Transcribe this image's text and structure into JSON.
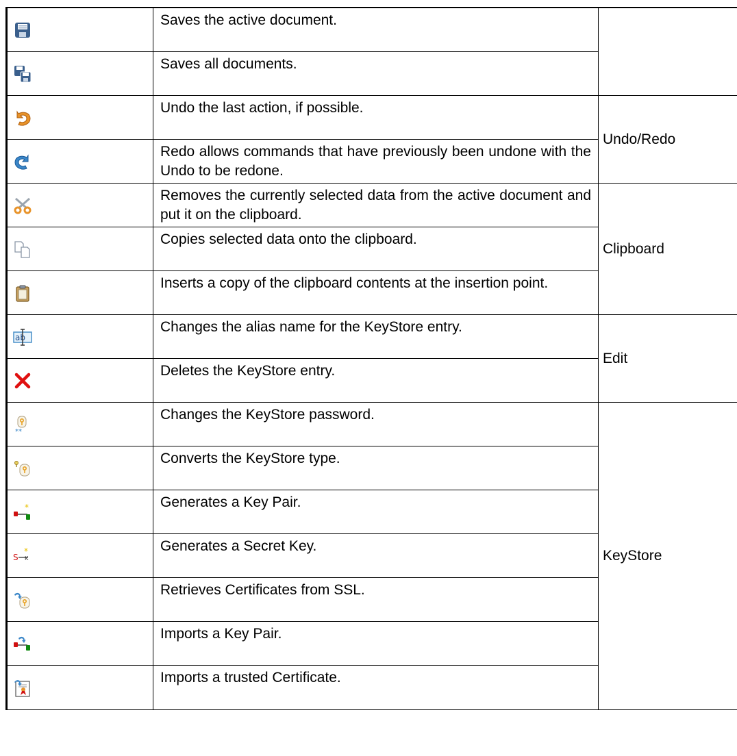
{
  "table": {
    "rows": [
      {
        "icon": "save-icon",
        "description": "Saves the active document."
      },
      {
        "icon": "save-all-icon",
        "description": "Saves all documents."
      },
      {
        "icon": "undo-icon",
        "description": "Undo the last action, if possible."
      },
      {
        "icon": "redo-icon",
        "description": "Redo allows commands that have previously been undone with the Undo to be redone."
      },
      {
        "icon": "cut-icon",
        "description": "Removes the currently selected data from the active document and put it on the clipboard."
      },
      {
        "icon": "copy-icon",
        "description": "Copies selected data onto the clipboard."
      },
      {
        "icon": "paste-icon",
        "description": "Inserts a copy of the clipboard contents at the insertion point."
      },
      {
        "icon": "rename-icon",
        "description": "Changes the alias name for the KeyStore entry."
      },
      {
        "icon": "delete-icon",
        "description": "Deletes the KeyStore entry."
      },
      {
        "icon": "keystore-password-icon",
        "description": "Changes the KeyStore password."
      },
      {
        "icon": "keystore-convert-icon",
        "description": "Converts the KeyStore type."
      },
      {
        "icon": "generate-key-pair-icon",
        "description": "Generates a Key Pair."
      },
      {
        "icon": "generate-secret-key-icon",
        "description": "Generates a Secret Key."
      },
      {
        "icon": "retrieve-ssl-icon",
        "description": "Retrieves Certificates from SSL."
      },
      {
        "icon": "import-key-pair-icon",
        "description": "Imports a Key Pair."
      },
      {
        "icon": "import-certificate-icon",
        "description": "Imports a trusted Certificate."
      }
    ],
    "groups": {
      "file": "",
      "undo_redo": "Undo/Redo",
      "clipboard": "Clipboard",
      "edit": "Edit",
      "keystore": "KeyStore"
    }
  },
  "colors": {
    "border": "#000000",
    "save_blue": "#3a5f8c",
    "undo_orange": "#e8932a",
    "redo_blue": "#3a86c8",
    "delete_red": "#e01010",
    "key_gold": "#e8a020",
    "key_red": "#d01010",
    "key_green": "#108a10"
  }
}
